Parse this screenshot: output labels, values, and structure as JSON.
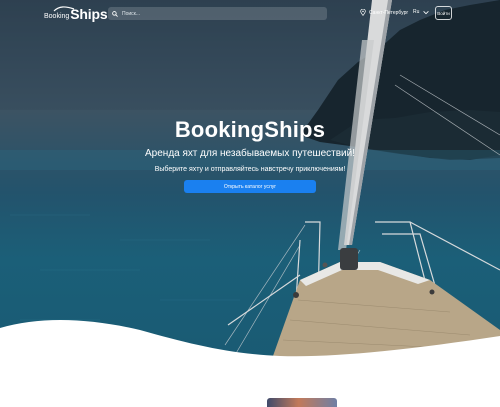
{
  "header": {
    "logo_prefix": "Booking",
    "logo_main": "Ships",
    "search_placeholder": "Поиск...",
    "city": "Санкт-Петербург",
    "language": "Ru",
    "login_label": "Войти"
  },
  "hero": {
    "title": "BookingShips",
    "subtitle": "Аренда яхт для незабываемых путешествий!",
    "tagline": "Выберите яхту и отправляйтесь навстречу приключениям!",
    "cta_label": "Открыть каталог услуг"
  },
  "icons": {
    "search": "search-icon",
    "location": "location-pin-icon",
    "language_dropdown": "chevron-down-icon",
    "logo": "wave-icon"
  },
  "colors": {
    "accent": "#1a80f0",
    "sea": "#1b5f78",
    "header_text": "#ffffff"
  }
}
